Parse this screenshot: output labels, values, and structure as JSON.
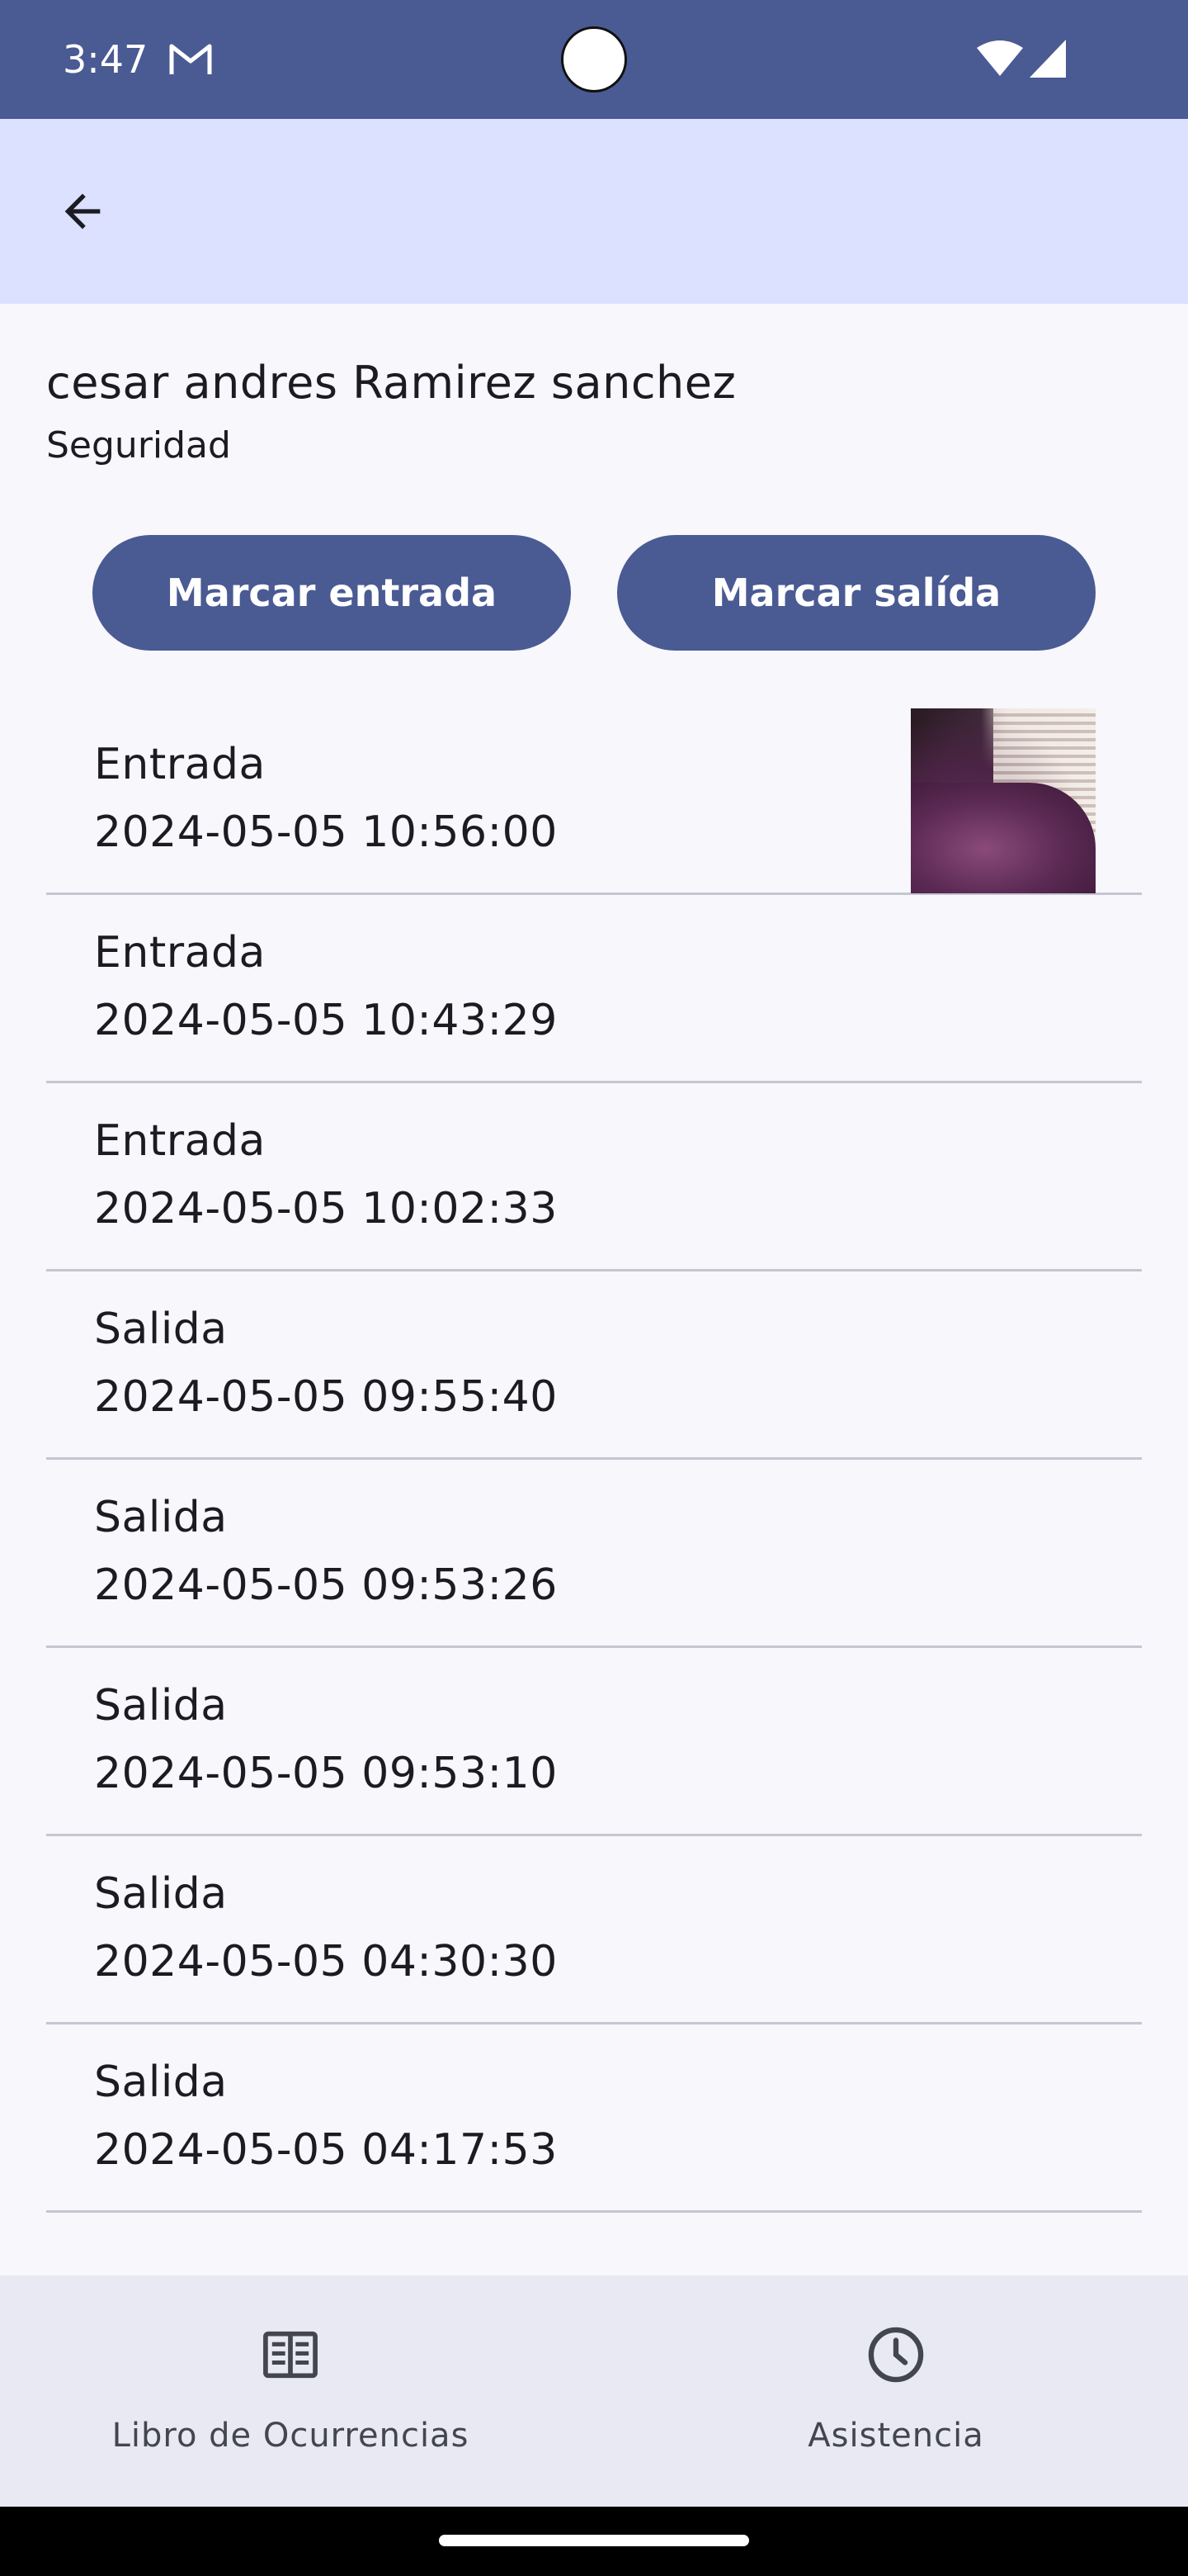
{
  "status_bar": {
    "time": "3:47",
    "icons": [
      "gmail-icon",
      "wifi-icon",
      "signal-icon"
    ]
  },
  "top_bar": {
    "back_icon": "arrow-left-icon"
  },
  "employee": {
    "name": "cesar andres Ramirez sanchez",
    "role": "Seguridad"
  },
  "actions": {
    "check_in_label": "Marcar entrada",
    "check_out_label": "Marcar salída"
  },
  "records": [
    {
      "type": "Entrada",
      "datetime": "2024-05-05 10:56:00",
      "has_photo": true
    },
    {
      "type": "Entrada",
      "datetime": "2024-05-05 10:43:29",
      "has_photo": false
    },
    {
      "type": "Entrada",
      "datetime": "2024-05-05 10:02:33",
      "has_photo": false
    },
    {
      "type": "Salida",
      "datetime": "2024-05-05 09:55:40",
      "has_photo": false
    },
    {
      "type": "Salida",
      "datetime": "2024-05-05 09:53:26",
      "has_photo": false
    },
    {
      "type": "Salida",
      "datetime": "2024-05-05 09:53:10",
      "has_photo": false
    },
    {
      "type": "Salida",
      "datetime": "2024-05-05 04:30:30",
      "has_photo": false
    },
    {
      "type": "Salida",
      "datetime": "2024-05-05 04:17:53",
      "has_photo": false
    }
  ],
  "bottom_nav": {
    "items": [
      {
        "label": "Libro de Ocurrencias",
        "icon": "book-icon"
      },
      {
        "label": "Asistencia",
        "icon": "clock-icon"
      }
    ]
  },
  "colors": {
    "primary": "#4a5a92",
    "app_bar": "#dbe1ff",
    "background": "#f7f7fc",
    "nav_background": "#e8e9f3",
    "divider": "#c4c6d0"
  }
}
